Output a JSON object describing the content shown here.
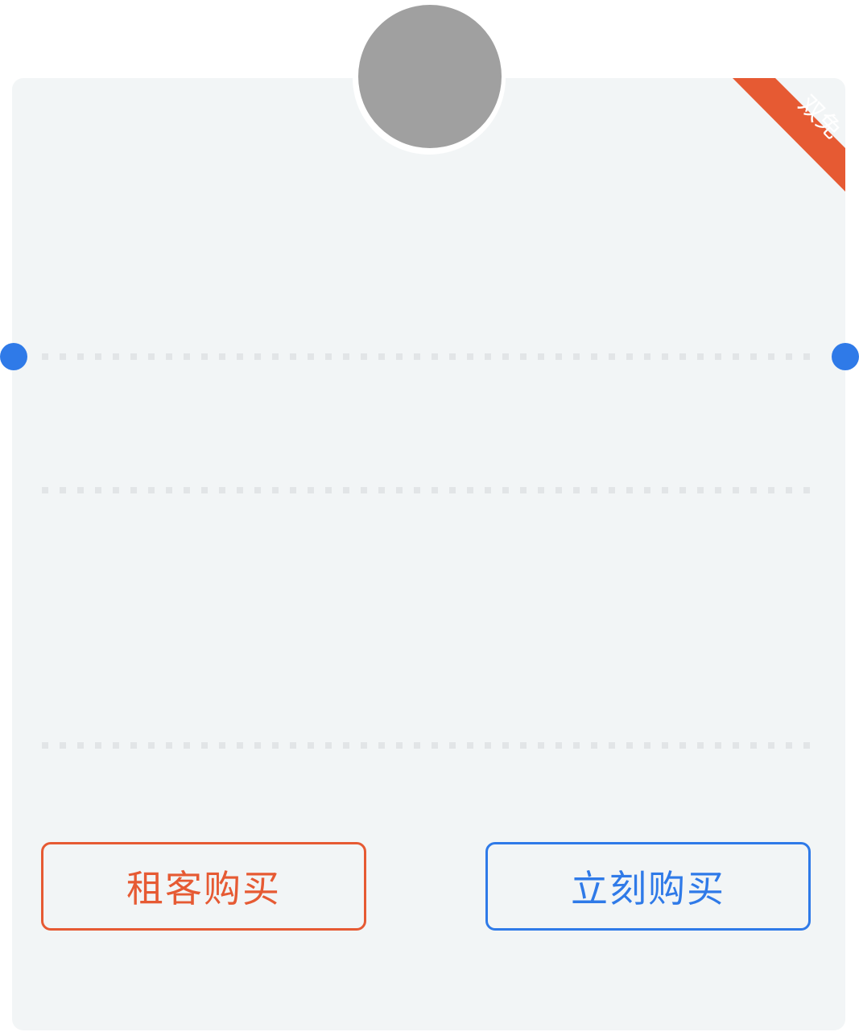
{
  "colors": {
    "card_background": "#f2f5f6",
    "avatar_placeholder": "#a0a0a0",
    "ribbon": "#e65a33",
    "accent_blue": "#2f7ae8",
    "accent_orange": "#e65a33",
    "separator": "#e2e5e7"
  },
  "badge": {
    "label": "双免"
  },
  "actions": {
    "tenant_buy_label": "租客购买",
    "buy_now_label": "立刻购买"
  },
  "icons": {
    "avatar": "avatar-placeholder-icon",
    "notch": "ticket-notch-icon"
  }
}
